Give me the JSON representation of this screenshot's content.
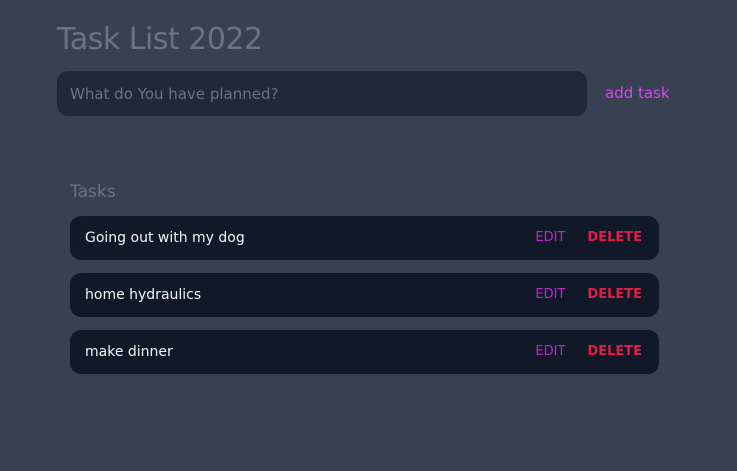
{
  "header": {
    "title": "Task List 2022"
  },
  "form": {
    "input_placeholder": "What do You have planned?",
    "input_value": "",
    "submit_label": "add task"
  },
  "tasks": {
    "heading": "Tasks",
    "edit_label": "EDIT",
    "delete_label": "DELETE",
    "items": [
      {
        "text": "Going out with my dog"
      },
      {
        "text": "home hydraulics"
      },
      {
        "text": "make dinner"
      }
    ]
  },
  "colors": {
    "background": "#374151",
    "input_background": "#1f2937",
    "task_background": "#111827",
    "accent": "#d946ef",
    "edit": "#c026d3",
    "delete": "#e11d48",
    "muted_text": "#6b7280"
  }
}
